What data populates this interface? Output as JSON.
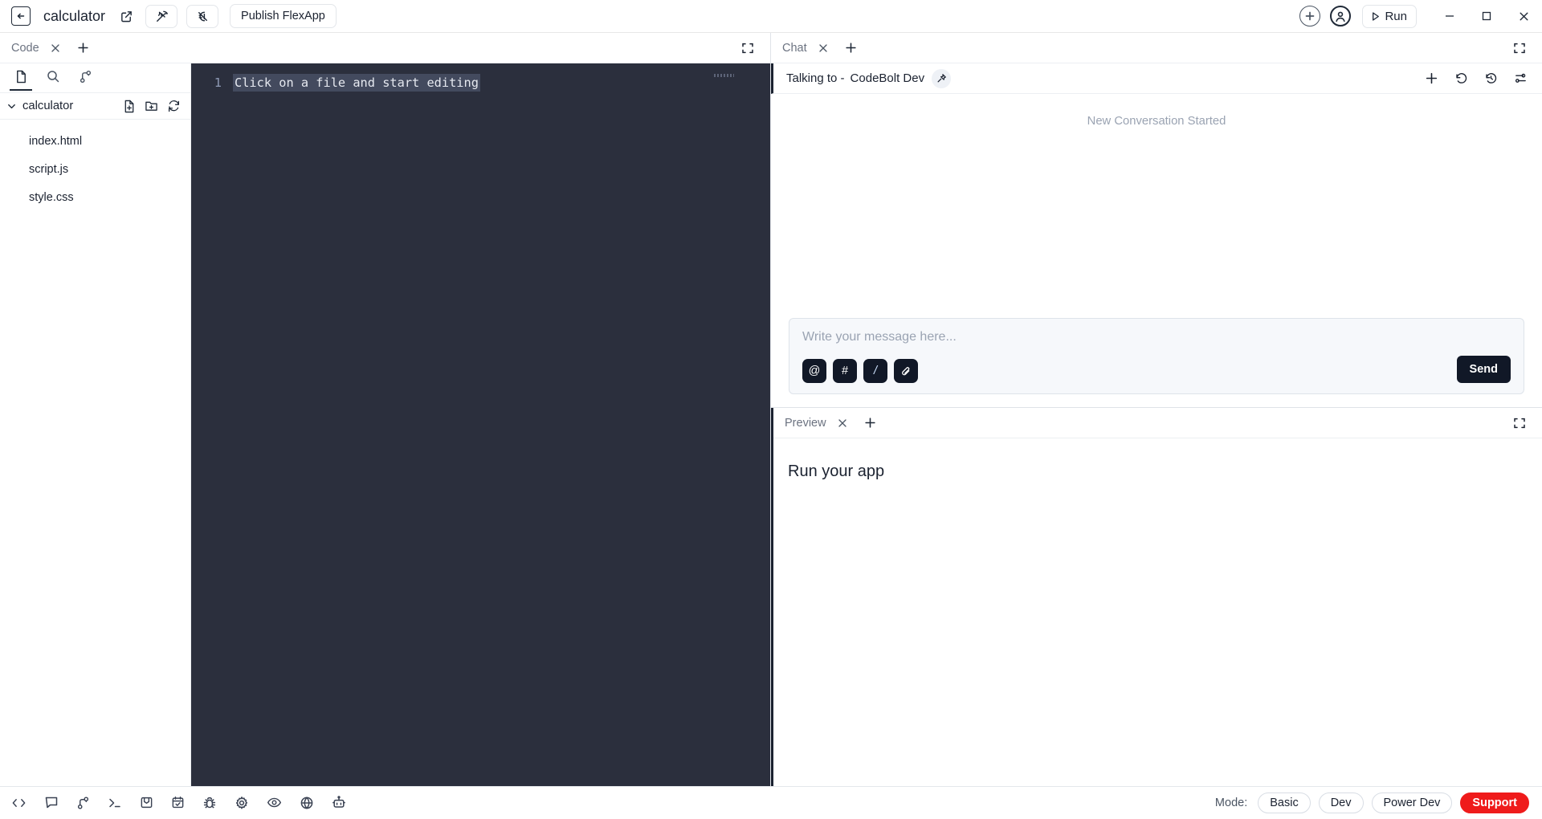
{
  "titlebar": {
    "back_icon": "back-arrow-icon",
    "project_title": "calculator",
    "external_link_icon": "external-link-icon",
    "build_icon": "pickaxe-icon",
    "plug_icon": "plug-disconnect-icon",
    "publish_label": "Publish FlexApp",
    "add_icon": "plus-circle-icon",
    "account_icon": "account-circle-icon",
    "run_label": "Run",
    "minimize_icon": "minimize-icon",
    "maximize_icon": "maximize-icon",
    "close_icon": "close-icon"
  },
  "code_panel": {
    "tab_label": "Code",
    "close_icon": "close-icon",
    "add_tab_icon": "plus-icon",
    "expand_icon": "fullscreen-icon",
    "sidebar": {
      "icons": [
        "files-icon",
        "search-icon",
        "source-control-icon"
      ],
      "root_name": "calculator",
      "chevron_icon": "chevron-down-icon",
      "actions": [
        "new-file-icon",
        "new-folder-icon",
        "refresh-icon"
      ],
      "files": [
        {
          "name": "index.html"
        },
        {
          "name": "script.js"
        },
        {
          "name": "style.css"
        }
      ]
    },
    "editor": {
      "line_number": "1",
      "content": "Click on a file and start editing"
    }
  },
  "chat_panel": {
    "tab_label": "Chat",
    "close_icon": "close-icon",
    "add_tab_icon": "plus-icon",
    "expand_icon": "fullscreen-icon",
    "talking_to_prefix": "Talking to -",
    "agent_name": "CodeBolt Dev",
    "pin_icon": "pin-icon",
    "actions": [
      "plus-icon",
      "undo-icon",
      "history-icon",
      "settings-sliders-icon"
    ],
    "conversation_status": "New Conversation Started",
    "composer": {
      "placeholder": "Write your message here...",
      "value": "",
      "chips": [
        {
          "label": "@",
          "name": "mention-chip"
        },
        {
          "label": "#",
          "name": "hash-chip"
        },
        {
          "label": "/",
          "name": "slash-command-chip"
        },
        {
          "label": "attach",
          "name": "attachment-chip"
        }
      ],
      "send_label": "Send"
    }
  },
  "preview_panel": {
    "tab_label": "Preview",
    "close_icon": "close-icon",
    "add_tab_icon": "plus-icon",
    "expand_icon": "fullscreen-icon",
    "message": "Run your app"
  },
  "statusbar": {
    "icons": [
      "code-brackets-icon",
      "chat-bubble-icon",
      "source-control-icon",
      "terminal-icon",
      "inbox-icon",
      "calendar-check-icon",
      "bug-icon",
      "gear-icon",
      "eye-icon",
      "globe-icon",
      "robot-icon"
    ],
    "mode_label": "Mode:",
    "modes": [
      "Basic",
      "Dev",
      "Power Dev"
    ],
    "support_label": "Support"
  },
  "colors": {
    "editor_bg": "#2b2f3d",
    "editor_highlight": "#434a5e",
    "support_red": "#ef1b1b",
    "chip_dark": "#111827"
  }
}
